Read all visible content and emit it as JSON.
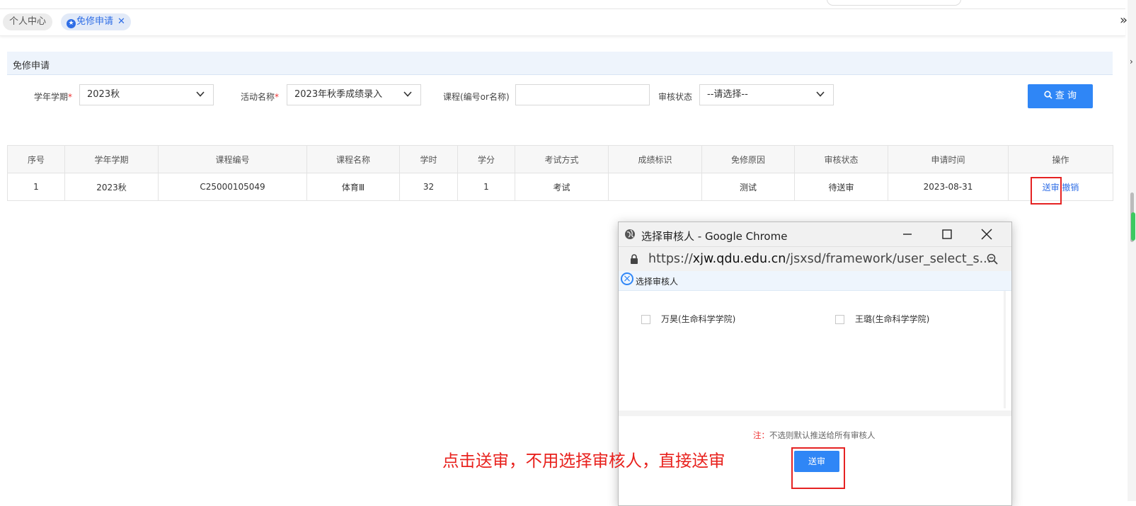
{
  "tabs": {
    "items": [
      {
        "label": "个人中心",
        "active": false
      },
      {
        "label": "免修申请",
        "active": true
      }
    ],
    "close_glyph": "✕",
    "expand_glyph": "»"
  },
  "panel": {
    "title": "免修申请"
  },
  "filters": {
    "term_label": "学年学期",
    "term_value": "2023秋",
    "activity_label": "活动名称",
    "activity_value": "2023年秋季成绩录入",
    "course_label": "课程(编号or名称)",
    "course_value": "",
    "status_label": "审核状态",
    "status_value": "--请选择--",
    "required_mark": "*",
    "query_label": "查 询"
  },
  "table": {
    "headers": [
      "序号",
      "学年学期",
      "课程编号",
      "课程名称",
      "学时",
      "学分",
      "考试方式",
      "成绩标识",
      "免修原因",
      "审核状态",
      "申请时间",
      "操作"
    ],
    "rows": [
      {
        "cells": [
          "1",
          "2023秋",
          "C25000105049",
          "体育Ⅲ",
          "32",
          "1",
          "考试",
          "",
          "测试",
          "待送审",
          "2023-08-31"
        ],
        "actions": [
          "送审",
          "撤销"
        ]
      }
    ]
  },
  "popup": {
    "window_title": "选择审核人 - Google Chrome",
    "url_prefix": "https://",
    "url_domain": "xjw.qdu.edu.cn",
    "url_path": "/jsxsd/framework/user_select_s...",
    "dialog_title": "选择审核人",
    "candidates": [
      {
        "name": "万昊(生命科学学院)",
        "checked": false
      },
      {
        "name": "王璐(生命科学学院)",
        "checked": false
      }
    ],
    "note_prefix": "注：",
    "note_text": "不选则默认推送给所有审核人",
    "submit_label": "送审"
  },
  "annotation": "点击送审，不用选择审核人，直接送审",
  "colors": {
    "accent": "#2f86f6",
    "highlight": "#e52222"
  }
}
